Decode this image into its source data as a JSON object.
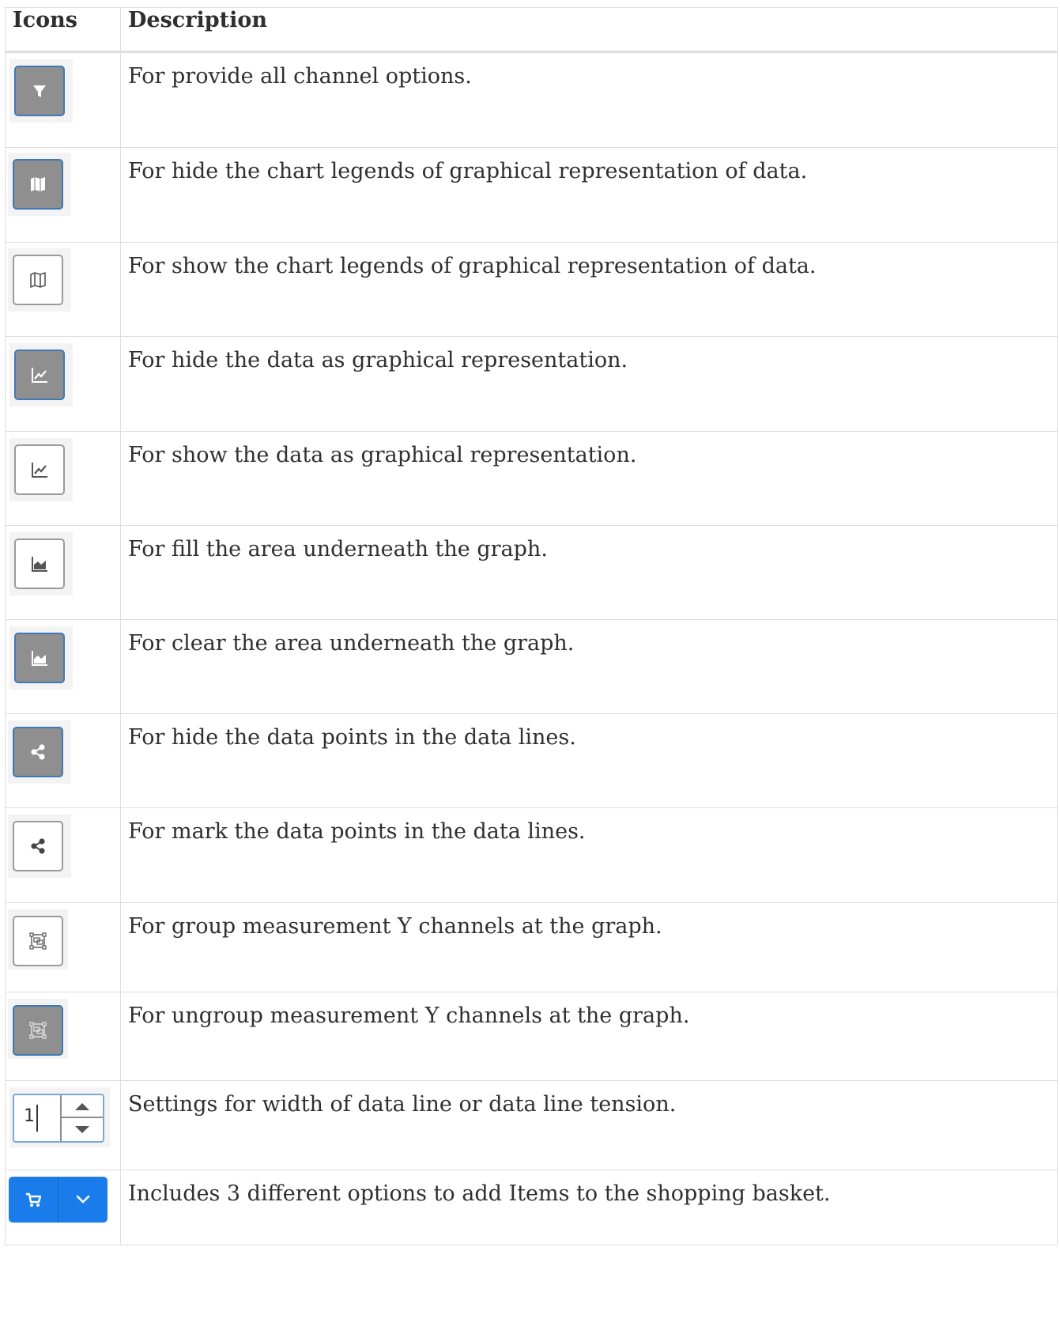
{
  "table": {
    "headers": {
      "icons": "Icons",
      "description": "Description"
    },
    "rows": [
      {
        "icon": "filter-icon",
        "state": "active",
        "description": "For provide all channel options."
      },
      {
        "icon": "map-filled-icon",
        "state": "active",
        "description": "For hide the chart legends of graphical representation of data."
      },
      {
        "icon": "map-outline-icon",
        "state": "inactive",
        "description": "For show the chart legends of graphical representation of data."
      },
      {
        "icon": "line-chart-icon",
        "state": "active",
        "description": "For hide the data as graphical representation."
      },
      {
        "icon": "line-chart-icon",
        "state": "inactive",
        "description": "For show the data as graphical representation."
      },
      {
        "icon": "area-chart-icon",
        "state": "inactive",
        "description": "For fill the area underneath the graph."
      },
      {
        "icon": "area-chart-icon",
        "state": "active",
        "description": "For clear the area underneath the graph."
      },
      {
        "icon": "share-nodes-icon",
        "state": "active",
        "description": "For hide the data points in the data lines."
      },
      {
        "icon": "share-nodes-icon",
        "state": "inactive",
        "description": "For mark the data points in the data lines."
      },
      {
        "icon": "group-objects-icon",
        "state": "inactive",
        "description": "For group measurement Y channels at the graph."
      },
      {
        "icon": "ungroup-objects-icon",
        "state": "active",
        "description": "For ungroup measurement Y channels at the graph."
      },
      {
        "icon": "number-spinner",
        "state": "input",
        "value": "1",
        "description": "Settings for width of data line or data line tension."
      },
      {
        "icon": "cart-split-button",
        "state": "primary",
        "description": "Includes 3 different options to add Items to the shopping basket."
      }
    ]
  },
  "colors": {
    "active_bg": "#8f8f8f",
    "active_border": "#3d79b7",
    "inactive_border": "#9a9a9a",
    "primary_blue": "#1a7bea"
  }
}
